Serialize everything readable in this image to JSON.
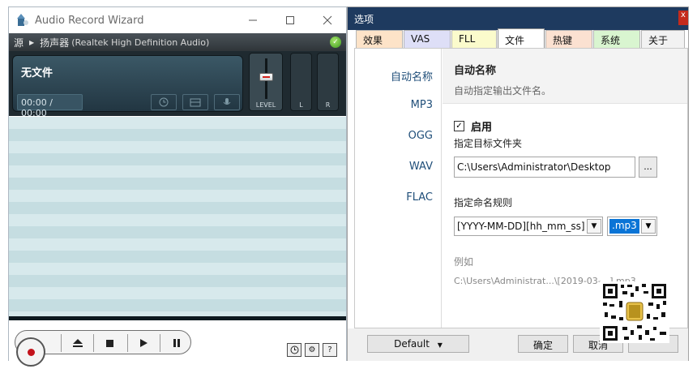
{
  "recorder": {
    "title": "Audio Record Wizard",
    "source_label": "源",
    "source_device": "扬声器",
    "source_device_detail": "(Realtek High Definition Audio)",
    "file_label": "无文件",
    "time": "00:00 / 00:00",
    "level_label": "LEVEL",
    "meter_left": "L",
    "meter_right": "R",
    "help_label": "?"
  },
  "options": {
    "title": "选项",
    "close_glyph": "x",
    "tabs": [
      {
        "label": "效果",
        "color": "#fde3c8"
      },
      {
        "label": "VAS",
        "color": "#dedff7"
      },
      {
        "label": "FLL",
        "color": "#fbfbcc"
      },
      {
        "label": "文件",
        "color": "#ffffff"
      },
      {
        "label": "热键",
        "color": "#fbe1d1"
      },
      {
        "label": "系统",
        "color": "#d9f5d0"
      },
      {
        "label": "关于",
        "color": "#f2f2f2"
      }
    ],
    "side_items": [
      "自动名称",
      "MP3",
      "OGG",
      "WAV",
      "FLAC"
    ],
    "section_title": "自动名称",
    "section_desc": "自动指定输出文件名。",
    "enable_label": "启用",
    "enable_checked": true,
    "folder_label": "指定目标文件夹",
    "folder_value": "C:\\Users\\Administrator\\Desktop",
    "browse_label": "...",
    "rule_label": "指定命名规则",
    "rule_value": "[YYYY-MM-DD][hh_mm_ss]",
    "ext_value": ".mp3",
    "example_label": "例如",
    "example_text": "C:\\Users\\Administrat...\\[2019-03-...].mp3",
    "footer": {
      "default_label": "Default",
      "ok_label": "确定",
      "cancel_label": "取消"
    }
  },
  "colors": {
    "record_red": "#c3121b",
    "options_title_bg": "#1e3a5f",
    "side_link": "#1f4e79",
    "ext_highlight": "#0a74d6"
  }
}
